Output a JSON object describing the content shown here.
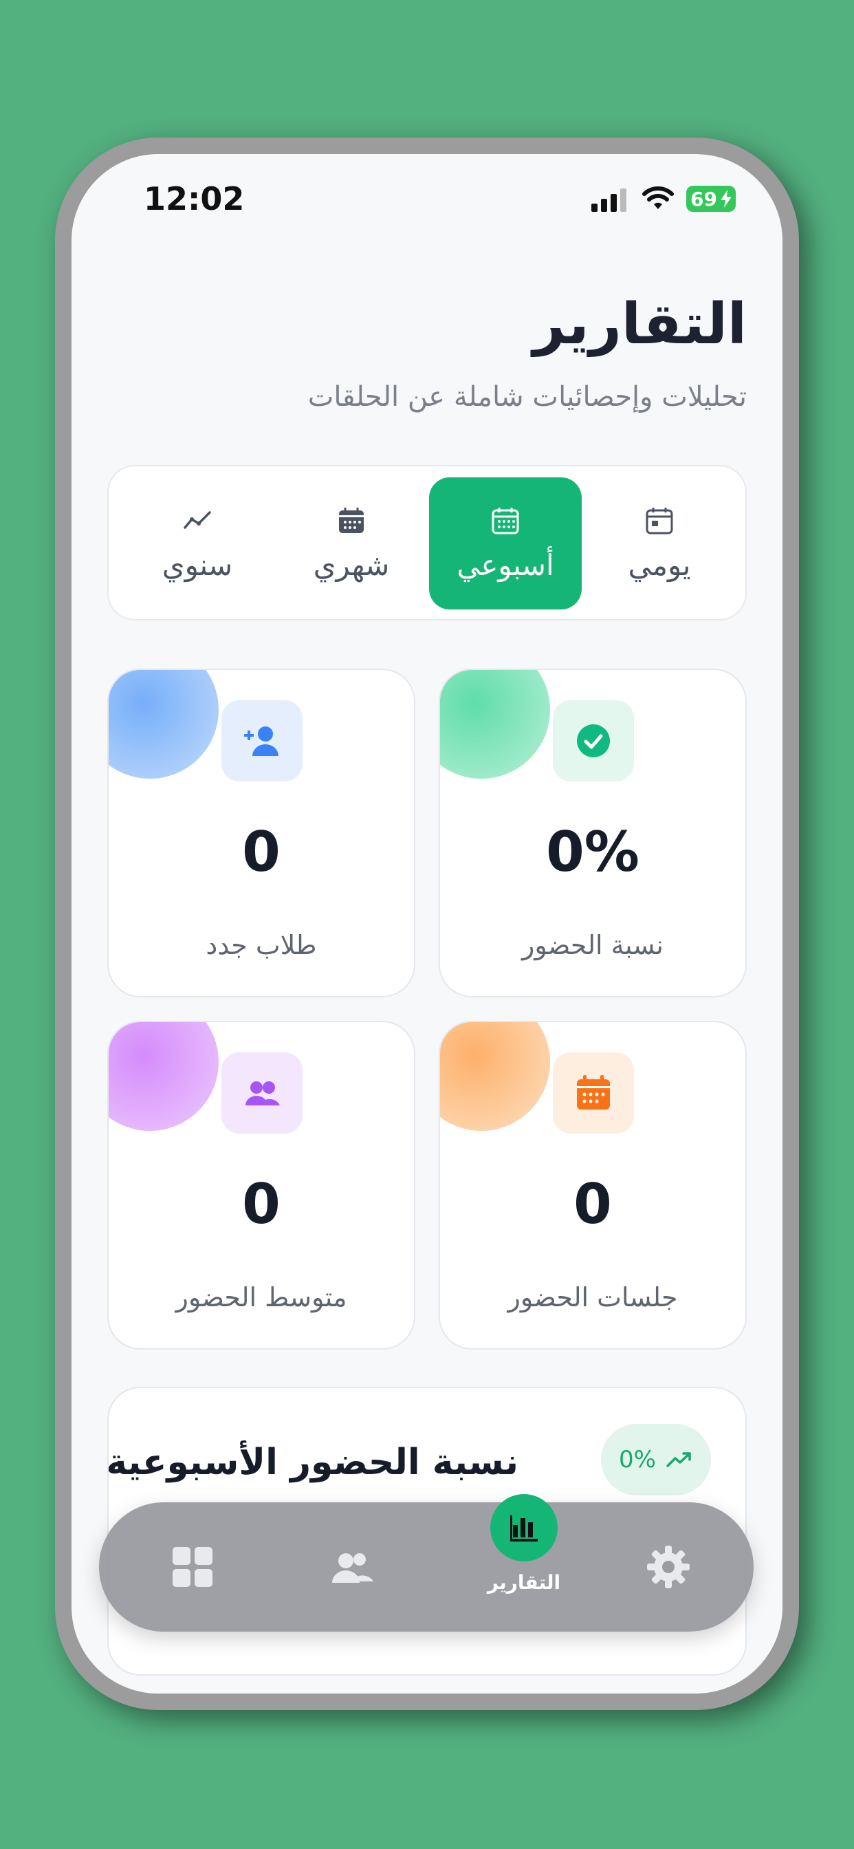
{
  "status_bar": {
    "time": "12:02",
    "battery": "69"
  },
  "header": {
    "title": "التقارير",
    "subtitle": "تحليلات وإحصائيات شاملة عن الحلقات"
  },
  "period_tabs": [
    {
      "label": "يومي",
      "icon": "calendar-day-icon"
    },
    {
      "label": "أسبوعي",
      "icon": "calendar-week-icon",
      "active": true
    },
    {
      "label": "شهري",
      "icon": "calendar-month-icon"
    },
    {
      "label": "سنوي",
      "icon": "trend-line-icon"
    }
  ],
  "stats": [
    {
      "value": "0%",
      "label": "نسبة الحضور",
      "icon": "check-circle-icon",
      "color": "#10b981"
    },
    {
      "value": "0",
      "label": "طلاب جدد",
      "icon": "user-plus-icon",
      "color": "#3b82f6"
    },
    {
      "value": "0",
      "label": "جلسات الحضور",
      "icon": "calendar-icon",
      "color": "#f97316"
    },
    {
      "value": "0",
      "label": "متوسط الحضور",
      "icon": "users-icon",
      "color": "#a855f7"
    }
  ],
  "weekly": {
    "title": "نسبة الحضور الأسبوعية",
    "badge": "0%",
    "badge_icon": "trend-up-icon"
  },
  "bottom_nav": {
    "reports_label": "التقارير",
    "items": [
      "dashboard-icon",
      "users-icon",
      "bar-chart-icon",
      "gear-icon"
    ]
  },
  "colors": {
    "accent": "#15b675",
    "background": "#53b07f"
  }
}
